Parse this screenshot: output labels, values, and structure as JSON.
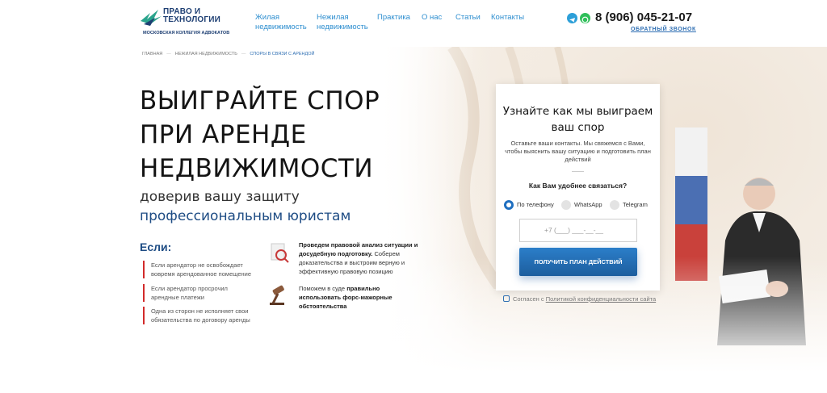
{
  "header": {
    "logo": {
      "name": "ПРАВО И ТЕХНОЛОГИИ",
      "tagline": "МОСКОВСКАЯ КОЛЛЕГИЯ АДВОКАТОВ"
    },
    "nav": [
      {
        "label": "Жилая\nнедвижимость"
      },
      {
        "label": "Нежилая\nнедвижимость"
      },
      {
        "label": "Практика"
      },
      {
        "label": "О нас"
      },
      {
        "label": "Статьи"
      },
      {
        "label": "Контакты"
      }
    ],
    "icons": [
      "telegram-icon",
      "whatsapp-icon"
    ],
    "phone": "8 (906) 045-21-07",
    "callback": "ОБРАТНЫЙ ЗВОНОК"
  },
  "breadcrumb": [
    "ГЛАВНАЯ",
    "НЕЖИЛАЯ НЕДВИЖИМОСТЬ",
    "СПОРЫ В СВЯЗИ С АРЕНДОЙ"
  ],
  "hero": {
    "title": "ВЫИГРАЙТЕ СПОР ПРИ АРЕНДЕ НЕДВИЖИМОСТИ",
    "subtitle_1": "доверив вашу защиту",
    "subtitle_2": "профессиональным юристам",
    "if_title": "Если:",
    "if_items": [
      "Если арендатор не освобождает вовремя арендованное помещение",
      "Если арендатор просрочил арендные платежи",
      "Одна из сторон не исполняет свои обязательства по договору аренды"
    ],
    "features": [
      {
        "bold": "Проведем правовой анализ ситуации и досудебную подготовку.",
        "text": " Соберем доказательства и выстроим верную и эффективную правовую позицию",
        "icon": "document-icon"
      },
      {
        "text": "Поможем в суде ",
        "bold": "правильно использовать форс-мажорные обстоятельства",
        "icon": "gavel-icon"
      }
    ]
  },
  "form": {
    "title": "Узнайте как мы выиграем ваш спор",
    "description": "Оставьте ваши контакты. Мы свяжемся с Вами, чтобы выяснить вашу ситуацию и подготовить план действий",
    "question": "Как Вам удобнее связаться?",
    "options": [
      {
        "label": "По телефону",
        "selected": true
      },
      {
        "label": "WhatsApp",
        "selected": false
      },
      {
        "label": "Telegram",
        "selected": false
      }
    ],
    "phone_placeholder": "+7 (___) ___-__-__",
    "submit": "ПОЛУЧИТЬ ПЛАН ДЕЙСТВИЙ",
    "consent_prefix": "Согласен с",
    "consent_link": "Политикой конфиденциальности сайта"
  },
  "colors": {
    "brand": "#1e4c84",
    "link": "#2f8fd0",
    "accent_red": "#d22b2b",
    "button": "#1d5e9e"
  }
}
